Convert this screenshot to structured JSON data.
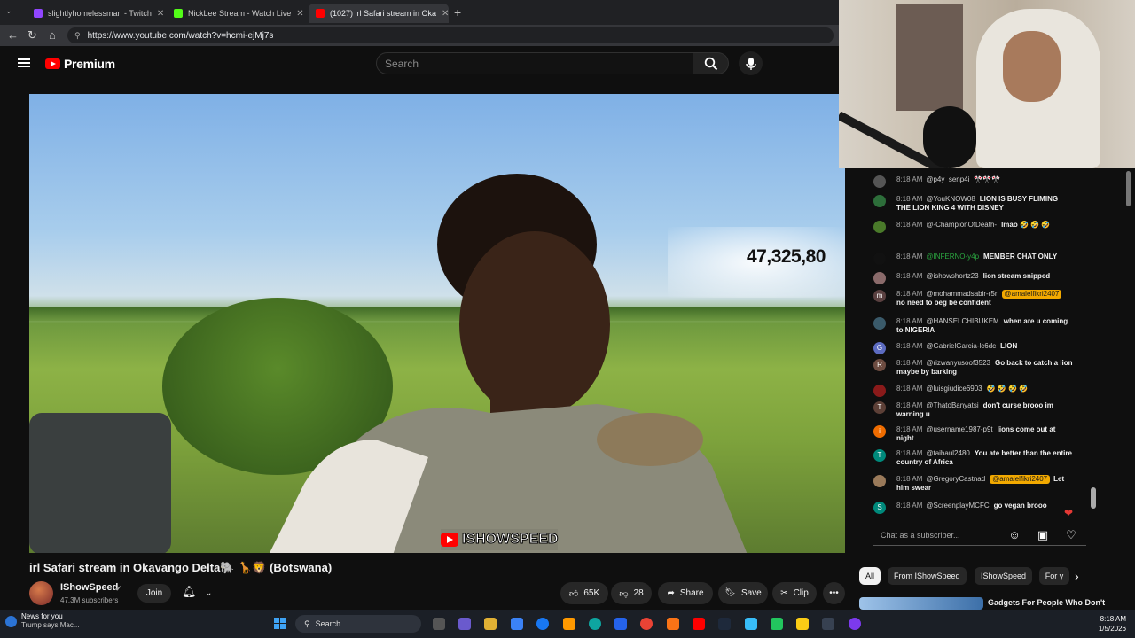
{
  "browser": {
    "tabs": [
      {
        "title": "slightlyhomelessman - Twitch",
        "favicon_color": "#9146ff"
      },
      {
        "title": "NickLee Stream - Watch Live",
        "favicon_color": "#53fc18"
      },
      {
        "title": "(1027) irl Safari stream in Oka",
        "favicon_color": "#ff0000"
      }
    ],
    "url": "https://www.youtube.com/watch?v=hcmi-ejMj7s"
  },
  "youtube": {
    "logo_text": "Premium",
    "search_placeholder": "Search",
    "video": {
      "overlay_count": "47,325,80",
      "watermark": "ISHOWSPEED",
      "title": "irl Safari stream in Okavango Delta🐘 🦒🦁 (Botswana)"
    },
    "channel": {
      "name": "IShowSpeed",
      "subscribers": "47.3M subscribers",
      "join_label": "Join"
    },
    "actions": {
      "likes": "65K",
      "dislikes": "28",
      "share": "Share",
      "save": "Save",
      "clip": "Clip"
    }
  },
  "chat": {
    "messages": [
      {
        "time": "8:18 AM",
        "user": "@p4y_senp4i",
        "text": "🎌🎌🎌",
        "avatar_color": "#555"
      },
      {
        "time": "8:18 AM",
        "user": "@YouKNOW08",
        "text": "LION IS BUSY FLIMING THE LION KING 4 WITH DISNEY",
        "avatar_color": "#2d6e3a"
      },
      {
        "time": "8:18 AM",
        "user": "@-ChampionOfDeath-",
        "text": "lmao 🤣 🤣 🤣",
        "avatar_color": "#4a7a2a"
      },
      {
        "time": "8:18 AM",
        "user": "@INFERNO-y4p",
        "text": "MEMBER CHAT ONLY",
        "avatar_color": "#111",
        "user_green": true
      },
      {
        "time": "8:18 AM",
        "user": "@ishowshortz23",
        "text": "lion stream snipped",
        "avatar_color": "#8a6a6a"
      },
      {
        "time": "8:18 AM",
        "user": "@mohammadsabir-r5r",
        "mention": "@amalelfikri2407",
        "text": "no need to beg be confident",
        "avatar_color": "#5a4040",
        "avatar_letter": "m"
      },
      {
        "time": "8:18 AM",
        "user": "@HANSELCHIBUKEM",
        "text": "when are u coming to NIGERIA",
        "avatar_color": "#3a5a6a"
      },
      {
        "time": "8:18 AM",
        "user": "@GabrielGarcia-lc6dc",
        "text": "LION",
        "avatar_color": "#5c6bc0",
        "avatar_letter": "G"
      },
      {
        "time": "8:18 AM",
        "user": "@rizwanyusoof3523",
        "text": "Go back to catch a lion maybe by barking",
        "avatar_color": "#6d4c41",
        "avatar_letter": "R"
      },
      {
        "time": "8:18 AM",
        "user": "@luisgiudice6903",
        "text": "🤣 🤣 🤣 🤣",
        "avatar_color": "#8a1a1a"
      },
      {
        "time": "8:18 AM",
        "user": "@ThatoBanyatsi",
        "text": "don't curse brooo im warning u",
        "avatar_color": "#5d4037",
        "avatar_letter": "T"
      },
      {
        "time": "8:18 AM",
        "user": "@username1987-p9t",
        "text": "lions come out at night",
        "avatar_color": "#ef6c00",
        "avatar_letter": "i"
      },
      {
        "time": "8:18 AM",
        "user": "@taihaul2480",
        "text": "You ate better than the entire country of Africa",
        "avatar_color": "#00897b",
        "avatar_letter": "T"
      },
      {
        "time": "8:18 AM",
        "user": "@GregoryCastnad",
        "mention": "@amalelfikri2407",
        "text": "Let him swear",
        "avatar_color": "#9a7a5a"
      },
      {
        "time": "8:18 AM",
        "user": "@ScreenplayMCFC",
        "text": "go vegan brooo",
        "avatar_color": "#00897b",
        "avatar_letter": "S"
      }
    ],
    "input_placeholder": "Chat as a subscriber...",
    "chips": [
      "All",
      "From IShowSpeed",
      "IShowSpeed",
      "For y"
    ],
    "recommendation_title": "Gadgets For People Who Don't"
  },
  "taskbar": {
    "news_title": "News for you",
    "news_sub": "Trump says Mac...",
    "search_label": "Search",
    "time": "8:18 AM",
    "date": "1/5/2026"
  }
}
